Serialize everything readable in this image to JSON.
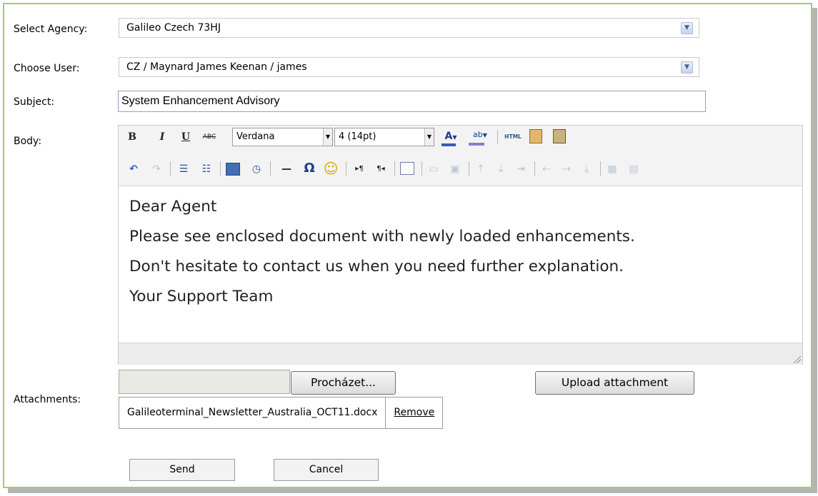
{
  "agency": {
    "label": "Select Agency:",
    "value": "Galileo Czech 73HJ"
  },
  "user": {
    "label": "Choose User:",
    "value": "CZ / Maynard James Keenan / james"
  },
  "subject": {
    "label": "Subject:",
    "value": "System Enhancement Advisory"
  },
  "body": {
    "label": "Body:",
    "font_family": "Verdana",
    "font_size": "4 (14pt)",
    "toolbar": {
      "bold": "B",
      "italic": "I",
      "underline": "U",
      "strike": "ABC",
      "html": "HTML",
      "omega": "Ω",
      "hr": "—",
      "ltr": "▸¶",
      "rtl": "¶◂"
    },
    "lines": [
      "Dear Agent",
      "Please see enclosed document with newly loaded enhancements.",
      "Don't hesitate to contact us when you need further explanation.",
      "Your Support Team"
    ]
  },
  "attachments": {
    "label": "Attachments:",
    "browse_label": "Procházet...",
    "upload_label": "Upload attachment",
    "file_name": "Galileoterminal_Newsletter_Australia_OCT11.docx",
    "remove_label": "Remove"
  },
  "actions": {
    "send": "Send",
    "cancel": "Cancel"
  }
}
